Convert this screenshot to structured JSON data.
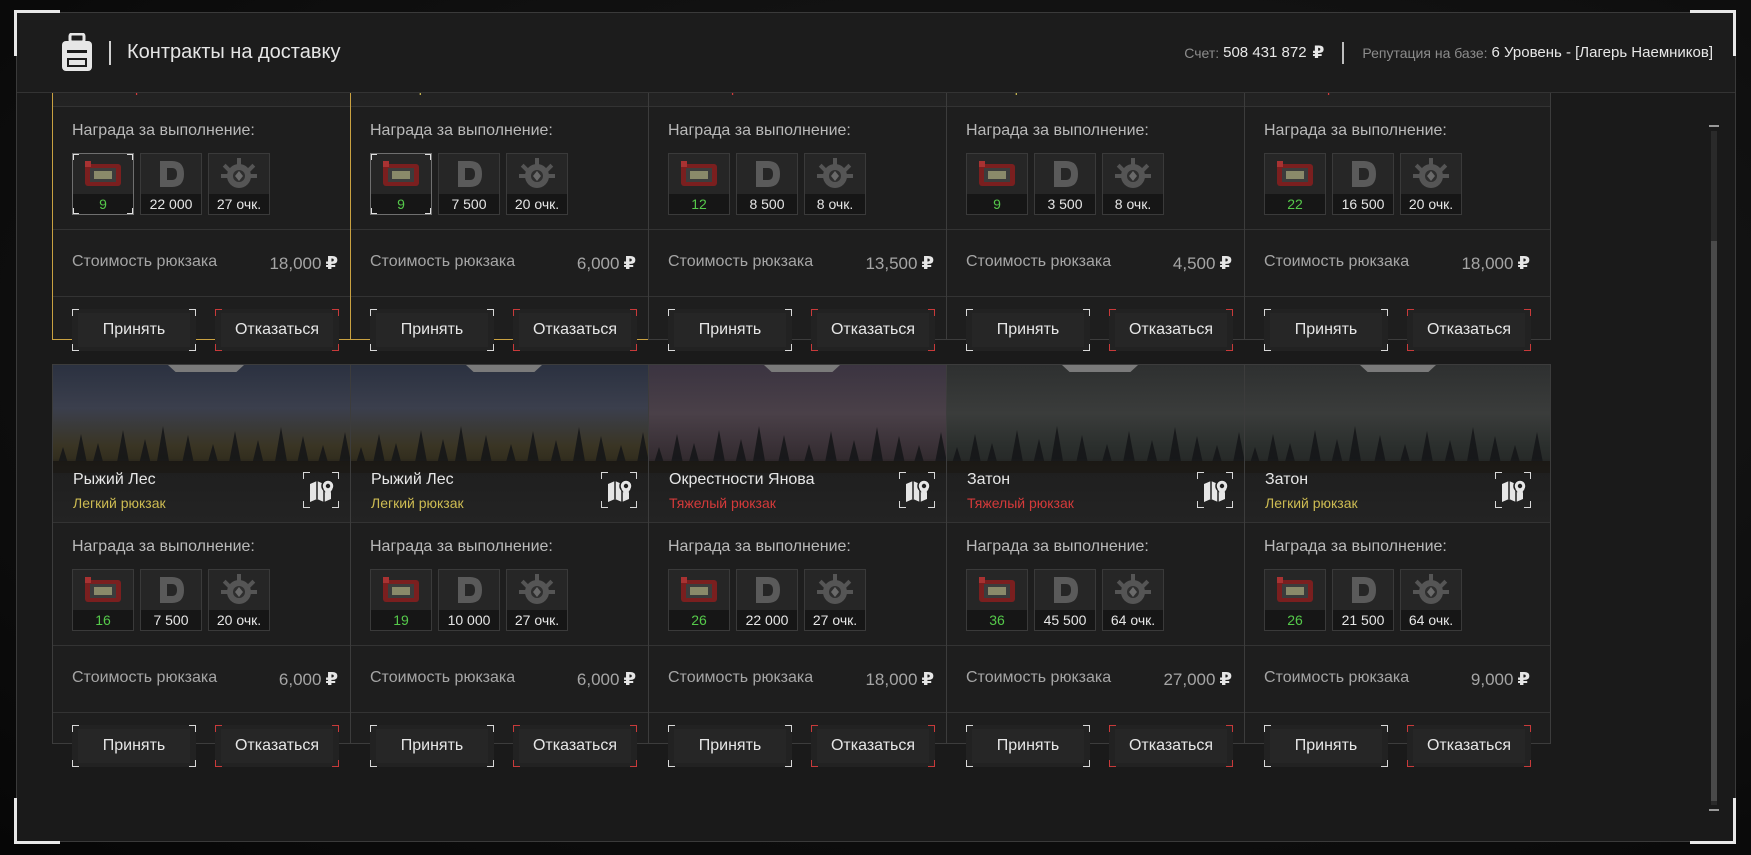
{
  "header": {
    "title": "Контракты на доставку",
    "account_label": "Счет:",
    "account_value": "508 431 872",
    "account_currency": "₽",
    "reputation_label": "Репутация на базе:",
    "reputation_value": "6 Уровень - [Лагерь Наемников]"
  },
  "labels": {
    "reward": "Награда за выполнение:",
    "cost": "Стоимость рюкзака",
    "accept": "Принять",
    "decline": "Отказаться",
    "currency": "₽"
  },
  "colors": {
    "heavy": "#d43a3a",
    "light": "#cdbb52",
    "selected_border": "#c9a141",
    "count_green": "#55c94a"
  },
  "cards_top": [
    {
      "kind": "Тяжелый рюкзак",
      "heavy": true,
      "selected": true,
      "items": "9",
      "money": "22 000",
      "points": "27 очк.",
      "cost": "18,000"
    },
    {
      "kind": "Легкий рюкзак",
      "heavy": false,
      "selected": true,
      "items": "9",
      "money": "7 500",
      "points": "20 очк.",
      "cost": "6,000"
    },
    {
      "kind": "Тяжелый рюкзак",
      "heavy": true,
      "selected": false,
      "items": "12",
      "money": "8 500",
      "points": "8 очк.",
      "cost": "13,500"
    },
    {
      "kind": "Легкий рюкзак",
      "heavy": false,
      "selected": false,
      "items": "9",
      "money": "3 500",
      "points": "8 очк.",
      "cost": "4,500"
    },
    {
      "kind": "Тяжелый рюкзак",
      "heavy": true,
      "selected": false,
      "items": "22",
      "money": "16 500",
      "points": "20 очк.",
      "cost": "18,000"
    }
  ],
  "cards_bottom": [
    {
      "location": "Рыжий Лес",
      "kind": "Легкий рюкзак",
      "heavy": false,
      "items": "16",
      "money": "7 500",
      "points": "20 очк.",
      "cost": "6,000",
      "scene": "forest"
    },
    {
      "location": "Рыжий Лес",
      "kind": "Легкий рюкзак",
      "heavy": false,
      "items": "19",
      "money": "10 000",
      "points": "27 очк.",
      "cost": "6,000",
      "scene": "forest"
    },
    {
      "location": "Окрестности Янова",
      "kind": "Тяжелый рюкзак",
      "heavy": true,
      "items": "26",
      "money": "22 000",
      "points": "27 очк.",
      "cost": "18,000",
      "scene": "purple"
    },
    {
      "location": "Затон",
      "kind": "Тяжелый рюкзак",
      "heavy": true,
      "items": "36",
      "money": "45 500",
      "points": "64 очк.",
      "cost": "27,000",
      "scene": "grey"
    },
    {
      "location": "Затон",
      "kind": "Легкий рюкзак",
      "heavy": false,
      "items": "26",
      "money": "21 500",
      "points": "64 очк.",
      "cost": "9,000",
      "scene": "grey"
    }
  ]
}
